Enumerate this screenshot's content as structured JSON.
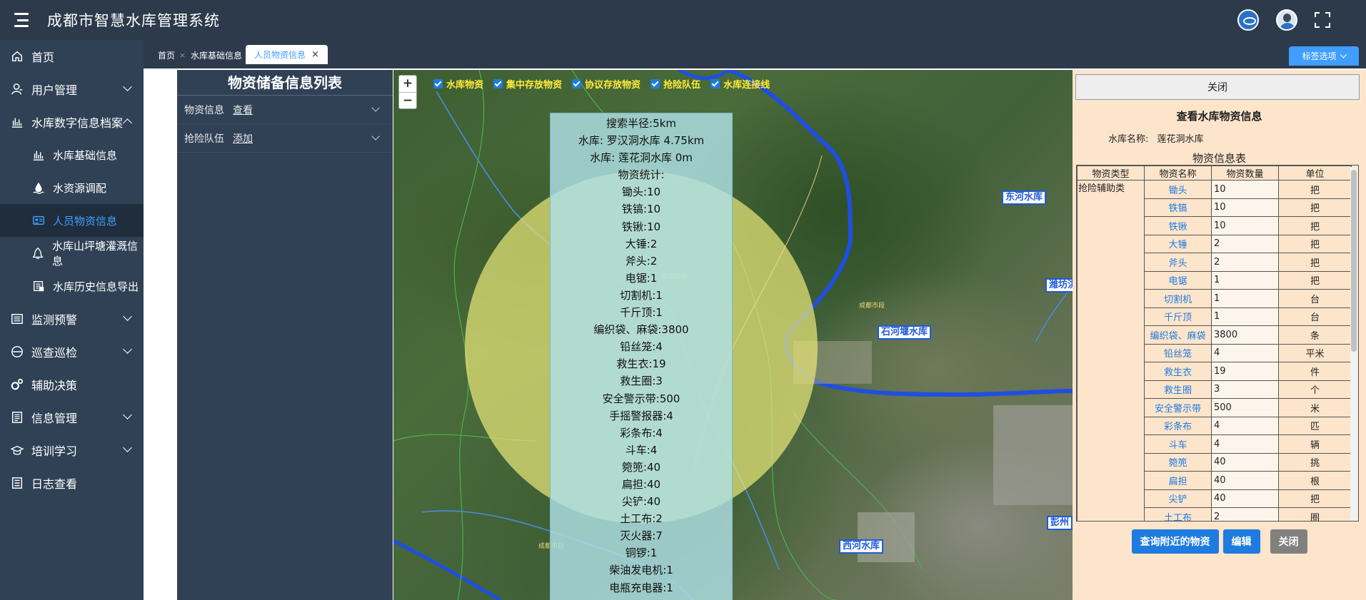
{
  "header": {
    "title": "成都市智慧水库管理系统"
  },
  "sidebar": {
    "items": [
      {
        "label": "首页",
        "icon": "home-icon",
        "arrow": ""
      },
      {
        "label": "用户管理",
        "icon": "user-icon",
        "arrow": "down"
      },
      {
        "label": "水库数字信息档案",
        "icon": "chart-bars-icon",
        "arrow": "up"
      },
      {
        "label": "水库基础信息",
        "icon": "chart-bars-icon",
        "sub": true
      },
      {
        "label": "水资源调配",
        "icon": "water-icon",
        "sub": true
      },
      {
        "label": "人员物资信息",
        "icon": "id-card-icon",
        "sub": true,
        "active": true
      },
      {
        "label": "水库山坪塘灌溉信息",
        "icon": "bell-icon",
        "sub": true
      },
      {
        "label": "水库历史信息导出",
        "icon": "export-icon",
        "sub": true
      },
      {
        "label": "监测预警",
        "icon": "monitor-icon",
        "arrow": "down"
      },
      {
        "label": "巡查巡检",
        "icon": "minus-circle-icon",
        "arrow": "down"
      },
      {
        "label": "辅助决策",
        "icon": "gears-icon",
        "arrow": ""
      },
      {
        "label": "信息管理",
        "icon": "document-icon",
        "arrow": "down"
      },
      {
        "label": "培训学习",
        "icon": "graduation-cap-icon",
        "arrow": "down"
      },
      {
        "label": "日志查看",
        "icon": "log-icon",
        "arrow": ""
      }
    ]
  },
  "tabs": {
    "items": [
      {
        "label": "首页",
        "close": "×"
      },
      {
        "label": "水库基础信息",
        "close": ""
      },
      {
        "label": "人员物资信息",
        "close": "×",
        "active": true
      }
    ],
    "options_label": "标签选项"
  },
  "list_panel": {
    "title": "物资储备信息列表",
    "rows": [
      {
        "label": "物资信息",
        "link": "查看"
      },
      {
        "label": "抢险队伍",
        "link": "添加"
      }
    ]
  },
  "map": {
    "zoom_in": "+",
    "zoom_out": "−",
    "layers": [
      {
        "label": "水库物资",
        "checked": true
      },
      {
        "label": "集中存放物资",
        "checked": true
      },
      {
        "label": "协议存放物资",
        "checked": true
      },
      {
        "label": "抢险队伍",
        "checked": true
      },
      {
        "label": "水库连接线",
        "checked": true
      }
    ],
    "info_lines": [
      "搜索半径:5km",
      "水库: 罗汉洞水库 4.75km",
      "水库: 莲花洞水库 0m",
      "物资统计:",
      "锄头:10",
      "铁镐:10",
      "铁锹:10",
      "大锤:2",
      "斧头:2",
      "电锯:1",
      "切割机:1",
      "千斤顶:1",
      "编织袋、麻袋:3800",
      "铅丝笼:4",
      "救生衣:19",
      "救生圈:3",
      "安全警示带:500",
      "手摇警报器:4",
      "彩条布:4",
      "斗车:4",
      "箢篼:40",
      "扁担:40",
      "尖铲:40",
      "土工布:2",
      "灭火器:7",
      "铜锣:1",
      "柴油发电机:1",
      "电瓶充电器:1"
    ],
    "labels": {
      "donghe": "东河水库",
      "weifang": "潍坊洪",
      "shihe": "石河堰水库",
      "xihe": "西河水库",
      "pengzhou": "彭州"
    }
  },
  "right_panel": {
    "close_top": "关闭",
    "title": "查看水库物资信息",
    "reservoir_label": "水库名称:",
    "reservoir_name": "莲花洞水库",
    "table_title": "物资信息表",
    "columns": [
      "物资类型",
      "物资名称",
      "物资数量",
      "单位"
    ],
    "category": "抢险辅助类",
    "rows": [
      {
        "name": "锄头",
        "qty": "10",
        "unit": "把"
      },
      {
        "name": "铁镐",
        "qty": "10",
        "unit": "把"
      },
      {
        "name": "铁锹",
        "qty": "10",
        "unit": "把"
      },
      {
        "name": "大锤",
        "qty": "2",
        "unit": "把"
      },
      {
        "name": "斧头",
        "qty": "2",
        "unit": "把"
      },
      {
        "name": "电锯",
        "qty": "1",
        "unit": "把"
      },
      {
        "name": "切割机",
        "qty": "1",
        "unit": "台"
      },
      {
        "name": "千斤顶",
        "qty": "1",
        "unit": "台"
      },
      {
        "name": "编织袋、麻袋",
        "qty": "3800",
        "unit": "条"
      },
      {
        "name": "铅丝笼",
        "qty": "4",
        "unit": "平米"
      },
      {
        "name": "救生衣",
        "qty": "19",
        "unit": "件"
      },
      {
        "name": "救生圈",
        "qty": "3",
        "unit": "个"
      },
      {
        "name": "安全警示带",
        "qty": "500",
        "unit": "米"
      },
      {
        "name": "彩条布",
        "qty": "4",
        "unit": "匹"
      },
      {
        "name": "斗车",
        "qty": "4",
        "unit": "辆"
      },
      {
        "name": "箢篼",
        "qty": "40",
        "unit": "挑"
      },
      {
        "name": "扁担",
        "qty": "40",
        "unit": "根"
      },
      {
        "name": "尖铲",
        "qty": "40",
        "unit": "把"
      },
      {
        "name": "土工布",
        "qty": "2",
        "unit": "圈"
      }
    ],
    "buttons": {
      "query_nearby": "查询附近的物资",
      "edit": "编辑",
      "close": "关闭"
    }
  }
}
